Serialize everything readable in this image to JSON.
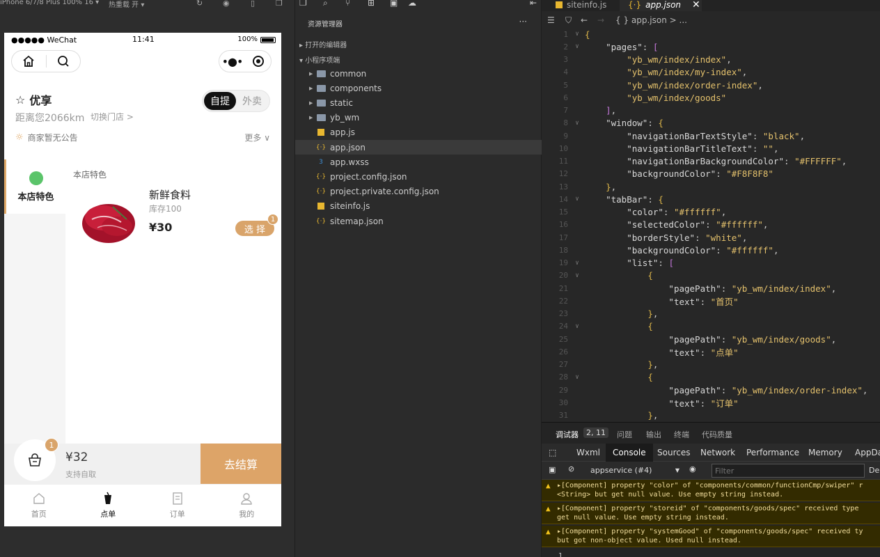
{
  "simulator": {
    "toolbar": {
      "device": "iPhone 6/7/8 Plus 100% 16 ▾",
      "reload": "热重载 开 ▾"
    },
    "status": {
      "carrier": "●●●●● WeChat",
      "time": "11:41",
      "battery": "100%"
    },
    "store": {
      "name": "优享",
      "distance": "距离您2066km",
      "switch": "切换门店 >",
      "mode_on": "自提",
      "mode_off": "外卖",
      "notice": "商家暂无公告",
      "more": "更多"
    },
    "category": {
      "active": "本店特色",
      "section_title": "本店特色"
    },
    "product": {
      "name": "新鲜食料",
      "stock": "库存100",
      "price": "¥30",
      "choose": "选 择",
      "badge": "1"
    },
    "cart": {
      "badge": "1",
      "total": "¥32",
      "sub": "支持自取",
      "checkout": "去结算"
    },
    "tabbar": [
      {
        "label": "首页",
        "icon": "home-icon"
      },
      {
        "label": "点单",
        "icon": "cup-icon"
      },
      {
        "label": "订单",
        "icon": "order-icon"
      },
      {
        "label": "我的",
        "icon": "user-icon"
      }
    ]
  },
  "explorer": {
    "header": "资源管理器",
    "open_editors": "打开的编辑器",
    "project": "小程序项端",
    "items": [
      {
        "label": "common",
        "type": "folder"
      },
      {
        "label": "components",
        "type": "folder"
      },
      {
        "label": "static",
        "type": "folder"
      },
      {
        "label": "yb_wm",
        "type": "folder"
      },
      {
        "label": "app.js",
        "type": "js"
      },
      {
        "label": "app.json",
        "type": "json"
      },
      {
        "label": "app.wxss",
        "type": "css"
      },
      {
        "label": "project.config.json",
        "type": "json"
      },
      {
        "label": "project.private.config.json",
        "type": "json"
      },
      {
        "label": "siteinfo.js",
        "type": "js"
      },
      {
        "label": "sitemap.json",
        "type": "json"
      }
    ]
  },
  "editor": {
    "tabs": [
      {
        "label": "siteinfo.js"
      },
      {
        "label": "app.json"
      }
    ],
    "breadcrumb": "{ } app.json > ...",
    "lines": [
      {
        "n": "1",
        "fold": "∨",
        "text": "{"
      },
      {
        "n": "2",
        "fold": "∨",
        "text": "    \"pages\": ["
      },
      {
        "n": "3",
        "fold": "",
        "text": "        \"yb_wm/index/index\","
      },
      {
        "n": "4",
        "fold": "",
        "text": "        \"yb_wm/index/my-index\","
      },
      {
        "n": "5",
        "fold": "",
        "text": "        \"yb_wm/index/order-index\","
      },
      {
        "n": "6",
        "fold": "",
        "text": "        \"yb_wm/index/goods\""
      },
      {
        "n": "7",
        "fold": "",
        "text": "    ],"
      },
      {
        "n": "8",
        "fold": "∨",
        "text": "    \"window\": {"
      },
      {
        "n": "9",
        "fold": "",
        "text": "        \"navigationBarTextStyle\": \"black\","
      },
      {
        "n": "10",
        "fold": "",
        "text": "        \"navigationBarTitleText\": \"\","
      },
      {
        "n": "11",
        "fold": "",
        "text": "        \"navigationBarBackgroundColor\": \"#FFFFFF\","
      },
      {
        "n": "12",
        "fold": "",
        "text": "        \"backgroundColor\": \"#F8F8F8\""
      },
      {
        "n": "13",
        "fold": "",
        "text": "    },"
      },
      {
        "n": "14",
        "fold": "∨",
        "text": "    \"tabBar\": {"
      },
      {
        "n": "15",
        "fold": "",
        "text": "        \"color\": \"#ffffff\","
      },
      {
        "n": "16",
        "fold": "",
        "text": "        \"selectedColor\": \"#ffffff\","
      },
      {
        "n": "17",
        "fold": "",
        "text": "        \"borderStyle\": \"white\","
      },
      {
        "n": "18",
        "fold": "",
        "text": "        \"backgroundColor\": \"#ffffff\","
      },
      {
        "n": "19",
        "fold": "∨",
        "text": "        \"list\": ["
      },
      {
        "n": "20",
        "fold": "∨",
        "text": "            {"
      },
      {
        "n": "21",
        "fold": "",
        "text": "                \"pagePath\": \"yb_wm/index/index\","
      },
      {
        "n": "22",
        "fold": "",
        "text": "                \"text\": \"首页\""
      },
      {
        "n": "23",
        "fold": "",
        "text": "            },"
      },
      {
        "n": "24",
        "fold": "∨",
        "text": "            {"
      },
      {
        "n": "25",
        "fold": "",
        "text": "                \"pagePath\": \"yb_wm/index/goods\","
      },
      {
        "n": "26",
        "fold": "",
        "text": "                \"text\": \"点单\""
      },
      {
        "n": "27",
        "fold": "",
        "text": "            },"
      },
      {
        "n": "28",
        "fold": "∨",
        "text": "            {"
      },
      {
        "n": "29",
        "fold": "",
        "text": "                \"pagePath\": \"yb_wm/index/order-index\","
      },
      {
        "n": "30",
        "fold": "",
        "text": "                \"text\": \"订单\""
      },
      {
        "n": "31",
        "fold": "",
        "text": "            },"
      }
    ]
  },
  "console": {
    "debugger_label": "调试器",
    "count": "2, 11",
    "panel_tabs": [
      "问题",
      "输出",
      "终端",
      "代码质量"
    ],
    "dev_tabs": [
      "Wxml",
      "Console",
      "Sources",
      "Network",
      "Performance",
      "Memory",
      "AppData"
    ],
    "context": "appservice (#4)",
    "filter_placeholder": "Filter",
    "default_levels": "De",
    "warnings": [
      {
        "line1": "▸[Component] property \"color\" of \"components/common/functionCmp/swiper\" r",
        "line2": "<String> but get null value. Use empty string instead."
      },
      {
        "line1": "▸[Component] property \"storeid\" of \"components/goods/spec\" received type",
        "line2": "get null value. Use empty string instead."
      },
      {
        "line1": "▸[Component] property \"systemGood\" of \"components/goods/spec\" received ty",
        "line2": "but got non-object value. Used null instead."
      }
    ],
    "last_line": "1"
  }
}
